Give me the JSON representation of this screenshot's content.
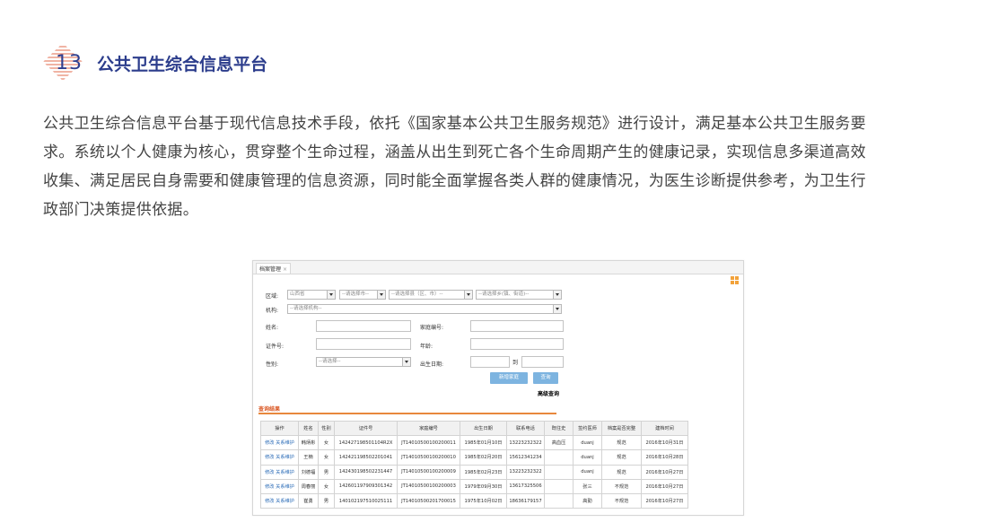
{
  "section": {
    "number": "13",
    "title": "公共卫生综合信息平台"
  },
  "intro": {
    "lines": [
      "公共卫生综合信息平台基于现代信息技术手段，依托《国家基本公共卫生服务规范》进行设计，满足基本公共卫生服务要",
      "求。系统以个人健康为核心，贯穿整个生命过程，涵盖从出生到死亡各个生命周期产生的健康记录，实现信息多渠道高效",
      "收集、满足居民自身需要和健康管理的信息资源，同时能全面掌握各类人群的健康情况，为医生诊断提供参考，为卫生行",
      "政部门决策提供依据。"
    ]
  },
  "colors": {
    "title": "#2c3d8c",
    "badge_stripes": "#e8866e",
    "accent_orange": "#e8883d",
    "button_blue": "#7db4e0",
    "link_blue": "#2a6bb7"
  },
  "screenshot": {
    "tab_label": "档案管理",
    "tab_close": "×",
    "form": {
      "region_label": "区域:",
      "province_value": "山西省",
      "city_placeholder": "--请选择市--",
      "district_placeholder": "--请选择县（区、市）--",
      "town_placeholder": "--请选择乡(镇、街道)--",
      "org_label": "机构:",
      "org_placeholder": "--请选择机构--",
      "name_label": "姓名:",
      "family_no_label": "家庭编号:",
      "id_label": "证件号:",
      "age_label": "年龄:",
      "gender_label": "性别:",
      "gender_placeholder": "--请选择--",
      "birth_label": "出生日期:",
      "birth_to": "到",
      "add_button": "新增家庭",
      "search_button": "查询",
      "advanced_link": "高级查询"
    },
    "results": {
      "title": "查询结果",
      "columns": [
        "操作",
        "姓名",
        "性别",
        "证件号",
        "家庭编号",
        "出生日期",
        "联系电话",
        "既往史",
        "签约医师",
        "档案是否完整",
        "建档时间"
      ],
      "rows": [
        [
          "修改 关系维护",
          "韩炳彬",
          "女",
          "142427198501104R2X",
          "JT14010500100200011",
          "1985年01月10日",
          "13223232322",
          "高血压",
          "duanj",
          "规范",
          "2016年10月31日"
        ],
        [
          "修改 关系维护",
          "王楠",
          "女",
          "142421198502201041",
          "JT14010500100200010",
          "1985年02月20日",
          "15612341234",
          "",
          "duanj",
          "规范",
          "2016年10月28日"
        ],
        [
          "修改 关系维护",
          "刘德福",
          "男",
          "142430198502231447",
          "JT14010500100200009",
          "1985年02月23日",
          "13223232322",
          "",
          "duanj",
          "规范",
          "2016年10月27日"
        ],
        [
          "修改 关系维护",
          "周春丽",
          "女",
          "142601197909301342",
          "JT14010500100200003",
          "1979年09月30日",
          "13617325506",
          "",
          "张三",
          "不规范",
          "2016年10月27日"
        ],
        [
          "修改 关系维护",
          "崔勇",
          "男",
          "140102197510025111",
          "JT14010500201700015",
          "1975年10月02日",
          "18636179157",
          "",
          "高勤",
          "不规范",
          "2016年10月27日"
        ]
      ]
    }
  }
}
